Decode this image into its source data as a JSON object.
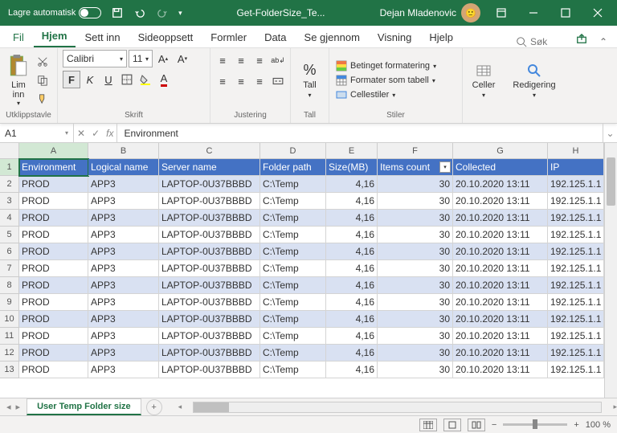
{
  "titlebar": {
    "autosave_label": "Lagre automatisk",
    "filename": "Get-FolderSize_Te...",
    "username": "Dejan Mladenovic"
  },
  "menu": {
    "file": "Fil",
    "home": "Hjem",
    "insert": "Sett inn",
    "pagelayout": "Sideoppsett",
    "formulas": "Formler",
    "data": "Data",
    "review": "Se gjennom",
    "view": "Visning",
    "help": "Hjelp",
    "search_placeholder": "Søk"
  },
  "ribbon": {
    "clipboard": {
      "paste": "Lim inn",
      "label": "Utklippstavle"
    },
    "font": {
      "name": "Calibri",
      "size": "11",
      "label": "Skrift"
    },
    "alignment": {
      "label": "Justering"
    },
    "number": {
      "main": "Tall",
      "label": "Tall"
    },
    "styles": {
      "cond": "Betinget formatering",
      "table": "Formater som tabell",
      "cell": "Cellestiler",
      "label": "Stiler"
    },
    "cells": {
      "main": "Celler"
    },
    "editing": {
      "main": "Redigering"
    }
  },
  "namebox": "A1",
  "formula": "Environment",
  "columns": [
    "A",
    "B",
    "C",
    "D",
    "E",
    "F",
    "G",
    "H"
  ],
  "headers": {
    "A": "Environment",
    "B": "Logical name",
    "C": "Server name",
    "D": "Folder path",
    "E": "Size(MB)",
    "F": "Items count",
    "G": "Collected",
    "H": "IP"
  },
  "filter_on": "F",
  "rows": [
    {
      "n": 2,
      "band": "a",
      "A": "PROD",
      "B": "APP3",
      "C": "LAPTOP-0U37BBBD",
      "D": "C:\\Temp",
      "E": "4,16",
      "F": "30",
      "G": "20.10.2020 13:11",
      "H": "192.125.1.1"
    },
    {
      "n": 3,
      "band": "b",
      "A": "PROD",
      "B": "APP3",
      "C": "LAPTOP-0U37BBBD",
      "D": "C:\\Temp",
      "E": "4,16",
      "F": "30",
      "G": "20.10.2020 13:11",
      "H": "192.125.1.1"
    },
    {
      "n": 4,
      "band": "a",
      "A": "PROD",
      "B": "APP3",
      "C": "LAPTOP-0U37BBBD",
      "D": "C:\\Temp",
      "E": "4,16",
      "F": "30",
      "G": "20.10.2020 13:11",
      "H": "192.125.1.1"
    },
    {
      "n": 5,
      "band": "b",
      "A": "PROD",
      "B": "APP3",
      "C": "LAPTOP-0U37BBBD",
      "D": "C:\\Temp",
      "E": "4,16",
      "F": "30",
      "G": "20.10.2020 13:11",
      "H": "192.125.1.1"
    },
    {
      "n": 6,
      "band": "a",
      "A": "PROD",
      "B": "APP3",
      "C": "LAPTOP-0U37BBBD",
      "D": "C:\\Temp",
      "E": "4,16",
      "F": "30",
      "G": "20.10.2020 13:11",
      "H": "192.125.1.1"
    },
    {
      "n": 7,
      "band": "b",
      "A": "PROD",
      "B": "APP3",
      "C": "LAPTOP-0U37BBBD",
      "D": "C:\\Temp",
      "E": "4,16",
      "F": "30",
      "G": "20.10.2020 13:11",
      "H": "192.125.1.1"
    },
    {
      "n": 8,
      "band": "a",
      "A": "PROD",
      "B": "APP3",
      "C": "LAPTOP-0U37BBBD",
      "D": "C:\\Temp",
      "E": "4,16",
      "F": "30",
      "G": "20.10.2020 13:11",
      "H": "192.125.1.1"
    },
    {
      "n": 9,
      "band": "b",
      "A": "PROD",
      "B": "APP3",
      "C": "LAPTOP-0U37BBBD",
      "D": "C:\\Temp",
      "E": "4,16",
      "F": "30",
      "G": "20.10.2020 13:11",
      "H": "192.125.1.1"
    },
    {
      "n": 10,
      "band": "a",
      "A": "PROD",
      "B": "APP3",
      "C": "LAPTOP-0U37BBBD",
      "D": "C:\\Temp",
      "E": "4,16",
      "F": "30",
      "G": "20.10.2020 13:11",
      "H": "192.125.1.1"
    },
    {
      "n": 11,
      "band": "b",
      "A": "PROD",
      "B": "APP3",
      "C": "LAPTOP-0U37BBBD",
      "D": "C:\\Temp",
      "E": "4,16",
      "F": "30",
      "G": "20.10.2020 13:11",
      "H": "192.125.1.1"
    },
    {
      "n": 12,
      "band": "a",
      "A": "PROD",
      "B": "APP3",
      "C": "LAPTOP-0U37BBBD",
      "D": "C:\\Temp",
      "E": "4,16",
      "F": "30",
      "G": "20.10.2020 13:11",
      "H": "192.125.1.1"
    },
    {
      "n": 13,
      "band": "b",
      "A": "PROD",
      "B": "APP3",
      "C": "LAPTOP-0U37BBBD",
      "D": "C:\\Temp",
      "E": "4,16",
      "F": "30",
      "G": "20.10.2020 13:11",
      "H": "192.125.1.1"
    }
  ],
  "sheet": {
    "active": "User Temp Folder size"
  },
  "statusbar": {
    "zoom": "100 %"
  }
}
